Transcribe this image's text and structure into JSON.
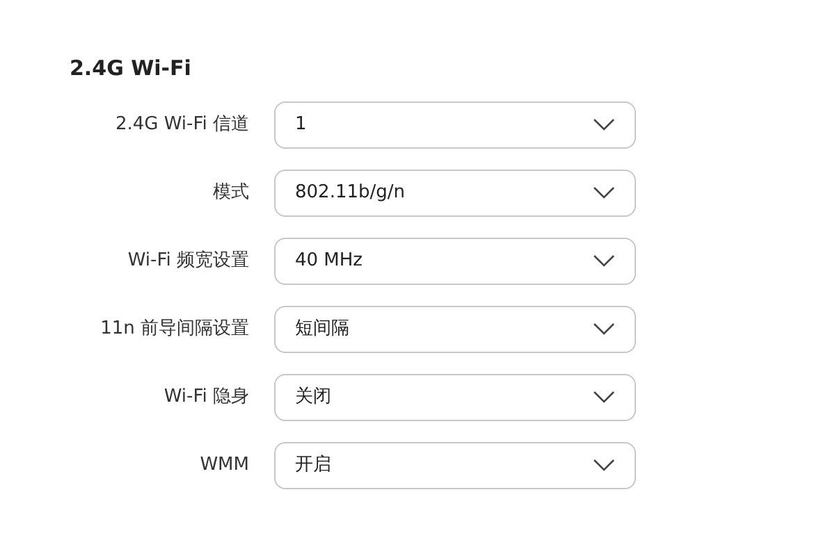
{
  "section_title": "2.4G Wi-Fi",
  "settings": [
    {
      "label": "2.4G Wi-Fi 信道",
      "value": "1"
    },
    {
      "label": "模式",
      "value": "802.11b/g/n"
    },
    {
      "label": "Wi-Fi 频宽设置",
      "value": "40 MHz"
    },
    {
      "label": "11n 前导间隔设置",
      "value": "短间隔"
    },
    {
      "label": "Wi-Fi 隐身",
      "value": "关闭"
    },
    {
      "label": "WMM",
      "value": "开启"
    }
  ]
}
